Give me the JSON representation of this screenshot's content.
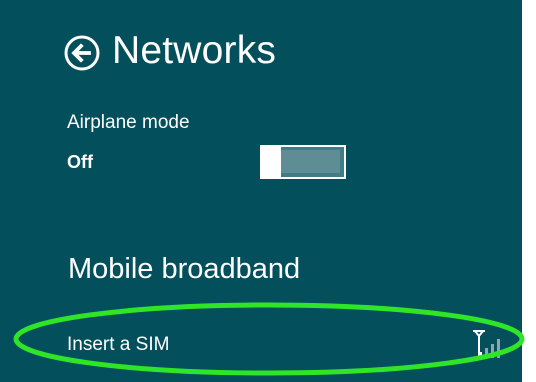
{
  "header": {
    "title": "Networks",
    "back_icon": "back-arrow-circle-icon"
  },
  "airplane_mode": {
    "label": "Airplane mode",
    "value": "Off",
    "enabled": false
  },
  "mobile_broadband": {
    "heading": "Mobile broadband",
    "item_label": "Insert a SIM",
    "signal_icon": "signal-strength-icon"
  },
  "colors": {
    "panel_background": "#034f5c",
    "text": "#ffffff",
    "highlight": "#2ee528",
    "toggle_off": "#417b85",
    "signal_inactive": "#8fa6aa"
  }
}
